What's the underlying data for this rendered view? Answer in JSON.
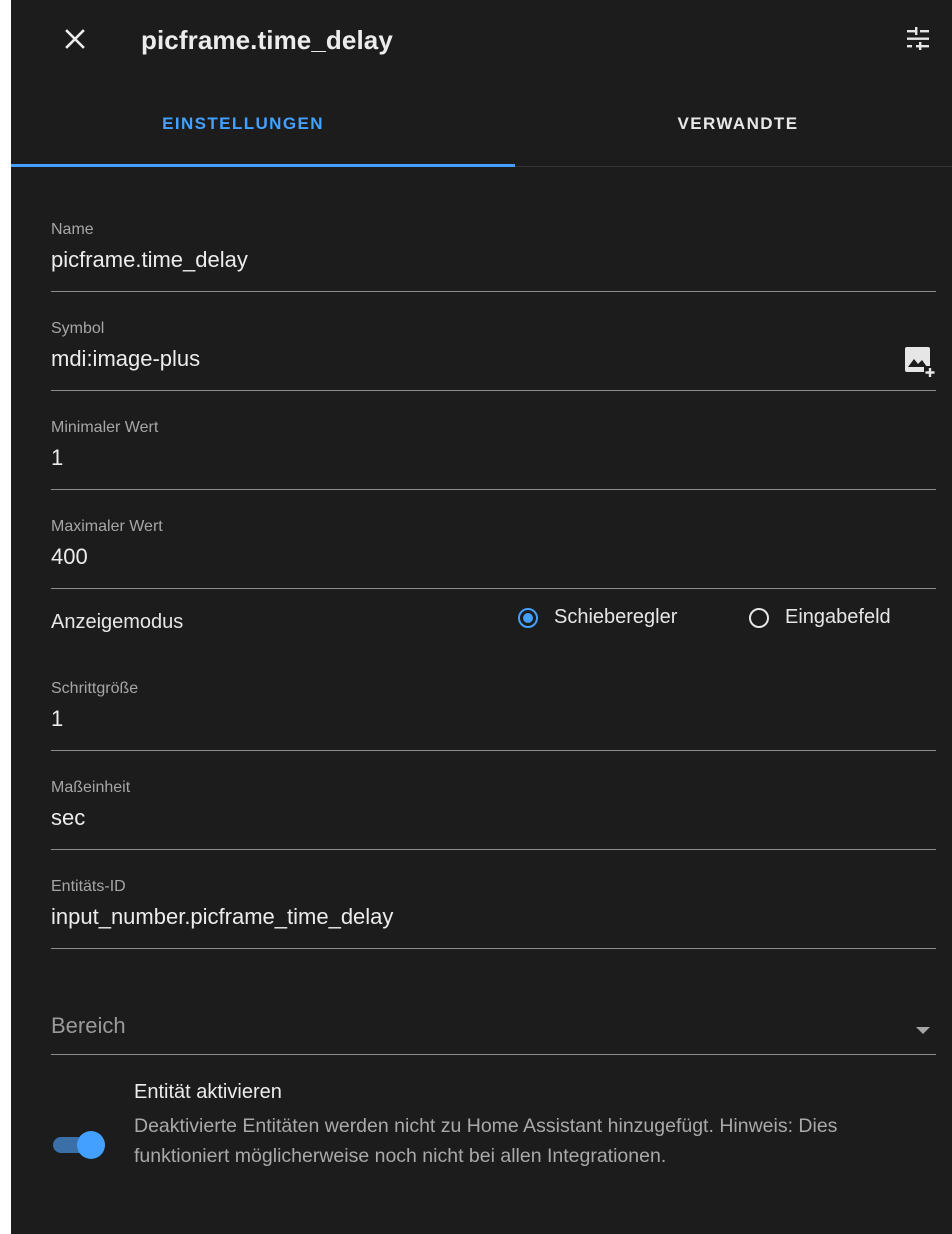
{
  "header": {
    "title": "picframe.time_delay",
    "close_icon": "close-icon",
    "settings_icon": "tune-icon"
  },
  "tabs": [
    {
      "label": "EINSTELLUNGEN",
      "active": true
    },
    {
      "label": "VERWANDTE",
      "active": false
    }
  ],
  "form": {
    "name": {
      "label": "Name",
      "value": "picframe.time_delay"
    },
    "symbol": {
      "label": "Symbol",
      "value": "mdi:image-plus",
      "icon": "image-plus-icon"
    },
    "min": {
      "label": "Minimaler Wert",
      "value": "1"
    },
    "max": {
      "label": "Maximaler Wert",
      "value": "400"
    },
    "display_mode": {
      "label": "Anzeigemodus",
      "options": [
        {
          "label": "Schieberegler",
          "selected": true
        },
        {
          "label": "Eingabefeld",
          "selected": false
        }
      ]
    },
    "step": {
      "label": "Schrittgröße",
      "value": "1"
    },
    "unit": {
      "label": "Maßeinheit",
      "value": "sec"
    },
    "entity_id": {
      "label": "Entitäts-ID",
      "value": "input_number.picframe_time_delay"
    },
    "area": {
      "placeholder": "Bereich"
    },
    "enable": {
      "title": "Entität aktivieren",
      "description": "Deaktivierte Entitäten werden nicht zu Home Assistant hinzugefügt. Hinweis: Dies funktioniert möglicherweise noch nicht bei allen Integrationen.",
      "enabled": true
    }
  },
  "colors": {
    "accent": "#43a0ff",
    "background": "#1c1c1c"
  }
}
